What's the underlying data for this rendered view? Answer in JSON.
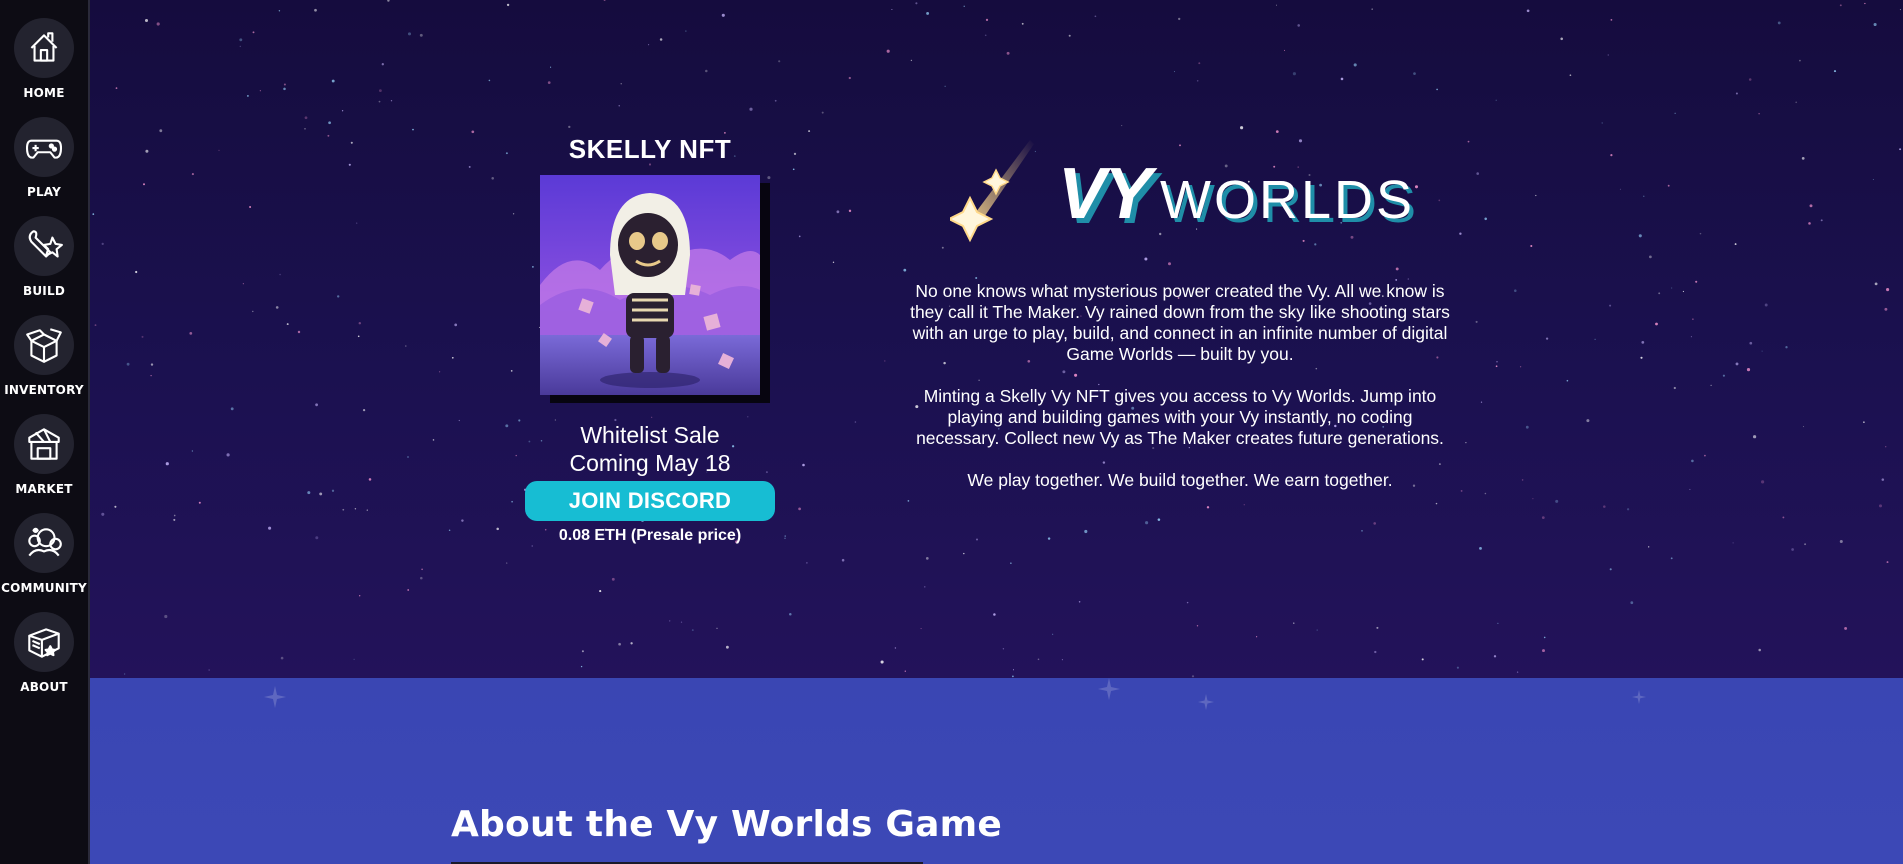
{
  "sidebar": {
    "items": [
      {
        "label": "HOME",
        "icon": "house-icon"
      },
      {
        "label": "PLAY",
        "icon": "gamepad-icon"
      },
      {
        "label": "BUILD",
        "icon": "wrench-icon"
      },
      {
        "label": "INVENTORY",
        "icon": "box-icon"
      },
      {
        "label": "MARKET",
        "icon": "market-stall-icon"
      },
      {
        "label": "COMMUNITY",
        "icon": "community-icon"
      },
      {
        "label": "ABOUT",
        "icon": "book-icon"
      }
    ]
  },
  "nft": {
    "title": "SKELLY NFT",
    "sale_line1": "Whitelist Sale",
    "sale_line2": "Coming May 18",
    "button_label": "JOIN DISCORD",
    "price": "0.08 ETH (Presale price)"
  },
  "logo": {
    "vy": "VY",
    "worlds": "WORLDS"
  },
  "intro": {
    "p1": "No one knows what mysterious power created the Vy. All we know is they call it The Maker. Vy rained down from the sky like shooting stars with an urge to play, build, and connect in an infinite number of digital Game Worlds — built by you.",
    "p2": "Minting a Skelly Vy NFT gives you access to Vy Worlds. Jump into playing and building games with your Vy instantly, no coding necessary. Collect new Vy as The Maker creates future generations.",
    "p3": "We play together. We build together. We earn together."
  },
  "about": {
    "heading": "About the Vy Worlds Game"
  },
  "colors": {
    "sidebar_bg": "#0d0c14",
    "hero_bg": "#1b1150",
    "accent_cyan": "#17bdd3",
    "about_bg": "#3a46b3"
  }
}
